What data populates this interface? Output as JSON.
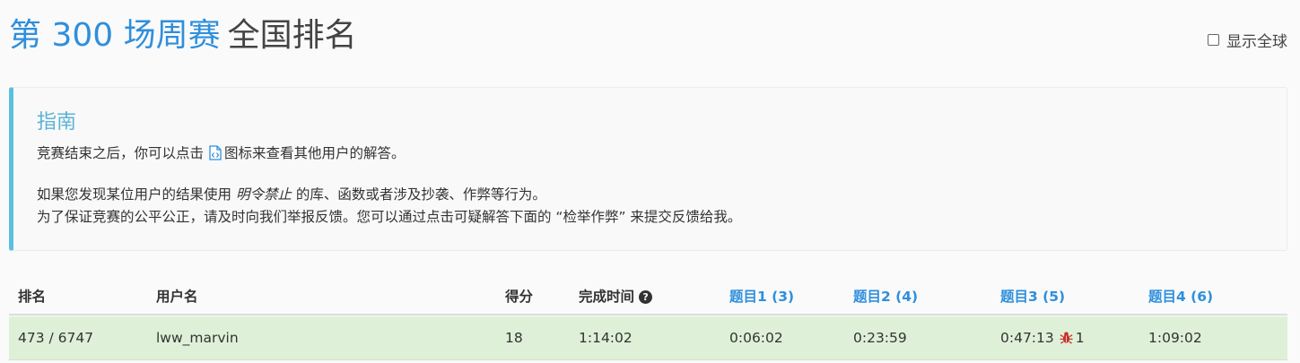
{
  "header": {
    "contest_title": "第 300 场周赛",
    "subtitle": "全国排名",
    "global_toggle_label": "显示全球"
  },
  "guide": {
    "title": "指南",
    "line1_before": "竞赛结束之后，你可以点击",
    "line1_after": "图标来查看其他用户的解答。",
    "line2_before": "如果您发现某位用户的结果使用",
    "line2_em": "明令禁止",
    "line2_after": "的库、函数或者涉及抄袭、作弊等行为。",
    "line3": "为了保证竞赛的公平公正，请及时向我们举报反馈。您可以通过点击可疑解答下面的 “检举作弊” 来提交反馈给我。"
  },
  "table": {
    "headers": {
      "rank": "排名",
      "username": "用户名",
      "score": "得分",
      "finish_time": "完成时间",
      "q1": "题目1 (3)",
      "q2": "题目2 (4)",
      "q3": "题目3 (5)",
      "q4": "题目4 (6)"
    },
    "rows": [
      {
        "rank": "473 / 6747",
        "username": "lww_marvin",
        "score": "18",
        "finish_time": "1:14:02",
        "q1": "0:06:02",
        "q2": "0:23:59",
        "q3": "0:47:13",
        "q3_bugs": "1",
        "q4": "1:09:02"
      }
    ]
  },
  "colors": {
    "accent": "#2f8fdc",
    "guide_border": "#5bc0de",
    "row_highlight": "#dff0d8",
    "bug": "#c9302c"
  },
  "icons": {
    "code": "code-icon",
    "help": "help-icon",
    "bug": "bug-icon"
  }
}
